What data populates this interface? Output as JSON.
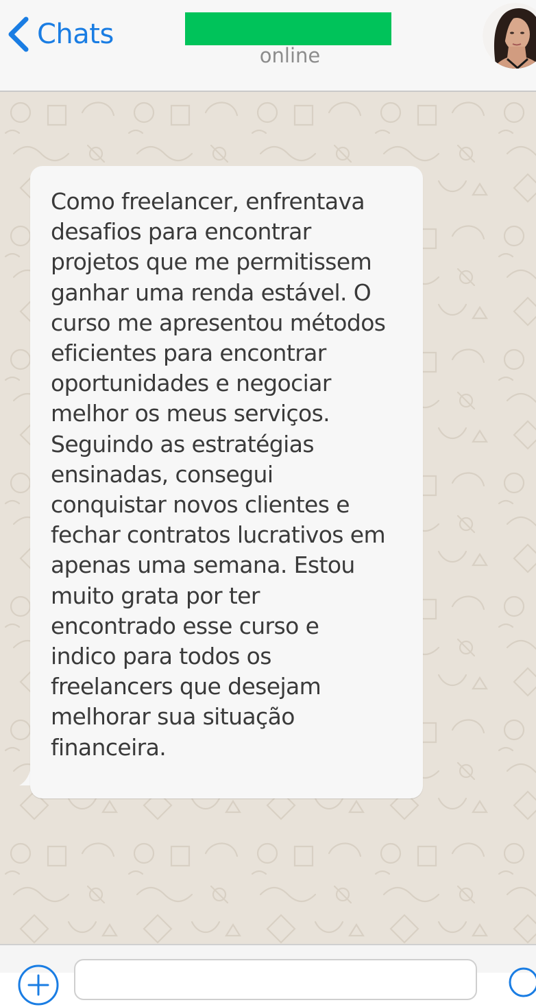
{
  "header": {
    "back_label": "Chats",
    "contact_name": "",
    "contact_name_highlight_color": "#00c35a",
    "status": "online",
    "avatar_icon": "contact-avatar"
  },
  "message": {
    "direction": "incoming",
    "text": "Como freelancer, enfrentava\ndesafios para encontrar\nprojetos que me permitissem\nganhar uma renda estável. O\ncurso me apresentou métodos\neficientes para encontrar\noportunidades e negociar\nmelhor os meus serviços.\nSeguindo as estratégias\nensinadas, consegui\nconquistar novos clientes e\nfechar contratos lucrativos em\napenas uma semana. Estou\nmuito grata por ter\nencontrado esse curso e\nindico para todos os\nfreelancers que desejam\nmelhorar sua situação\nfinanceira."
  },
  "input_bar": {
    "plus_icon": "plus-icon",
    "message_placeholder": "",
    "camera_icon": "camera-icon"
  },
  "colors": {
    "accent": "#1a7de3",
    "header_bg": "#f7f7f7",
    "wallpaper_bg": "#e8e2d9",
    "bubble_bg": "#f7f7f7",
    "status_text": "#8c8c8c"
  }
}
